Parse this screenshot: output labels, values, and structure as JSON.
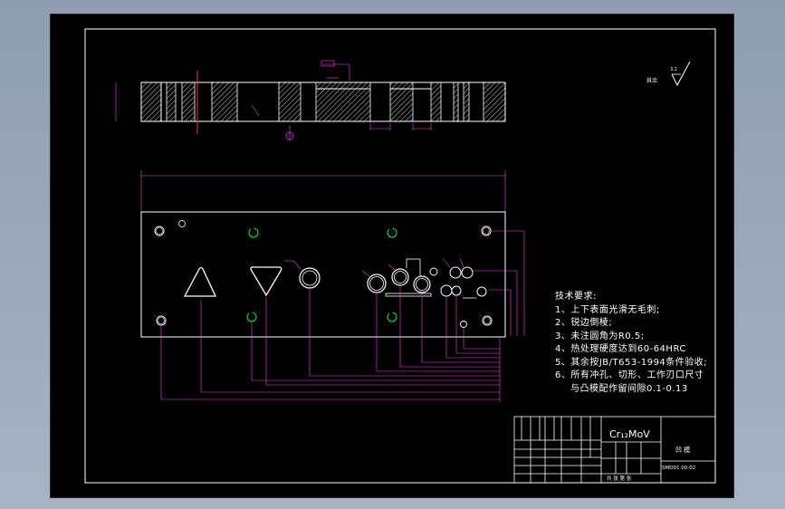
{
  "tech_requirements": {
    "title": "技术要求:",
    "items": [
      "1、上下表面光滑无毛刺;",
      "2、锐边倒棱;",
      "3、未注圆角为R0.5;",
      "4、热处理硬度达到60-64HRC",
      "5、其余按JB/T653-1994条件验收;",
      "6、所有冲孔、切形、工作刃口尺寸",
      "与凸模配作留间隙0.1-0.13"
    ]
  },
  "roughness_symbol": "其余",
  "title_block": {
    "material": "Cr₁₂MoV",
    "part_name": "凹 模",
    "drawing_no": "SMD01.00-02",
    "scale_label": "共 张 第 张"
  },
  "colors": {
    "frame": "#ffffff",
    "outline": "#ffffff",
    "dimension": "#ff3cff",
    "center_line": "#ff3030",
    "hidden_circle": "#00ff40",
    "hatch": "#ffffff"
  }
}
